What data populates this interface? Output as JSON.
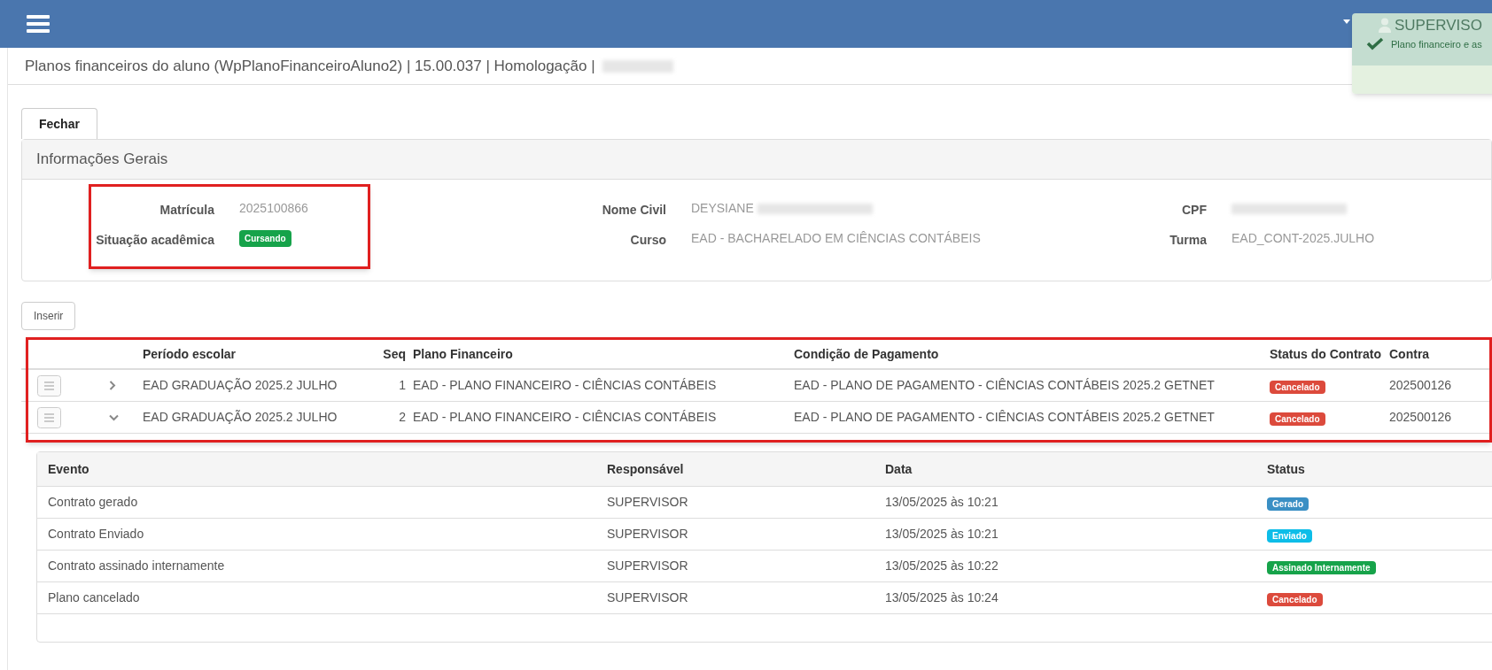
{
  "topbar": {
    "user": "SUPERVISO"
  },
  "toast": {
    "message": "Plano financeiro e as"
  },
  "page_title": {
    "text": "Planos financeiros do aluno (WpPlanoFinanceiroAluno2) | 15.00.037 | Homologação |",
    "redacted": true
  },
  "buttons": {
    "close": "Fechar",
    "insert": "Inserir"
  },
  "general_info": {
    "title": "Informações Gerais",
    "columns": [
      {
        "highlighted": true,
        "fields": [
          {
            "label": "Matrícula",
            "value": "2025100866",
            "kind": "text",
            "redacted": false
          },
          {
            "label": "Situação acadêmica",
            "value": "Cursando",
            "kind": "badge",
            "color": "#16a34a",
            "redacted": false
          }
        ]
      },
      {
        "highlighted": false,
        "fields": [
          {
            "label": "Nome Civil",
            "value": "DEYSIANE",
            "kind": "text",
            "redacted": true
          },
          {
            "label": "Curso",
            "value": "EAD - BACHARELADO EM CIÊNCIAS CONTÁBEIS",
            "kind": "text",
            "redacted": false
          }
        ]
      },
      {
        "highlighted": false,
        "fields": [
          {
            "label": "CPF",
            "kind": "hidden",
            "redacted": true
          },
          {
            "label": "Turma",
            "value": "EAD_CONT-2025.JULHO",
            "kind": "text",
            "redacted": false
          }
        ]
      }
    ]
  },
  "plans_table": {
    "highlighted": true,
    "columns": [
      "Período escolar",
      "Seq",
      "Plano Financeiro",
      "Condição de Pagamento",
      "Status do Contrato",
      "Contra"
    ],
    "rows": [
      {
        "expanded": false,
        "cells": [
          "EAD GRADUAÇÃO 2025.2 JULHO",
          "1",
          "EAD - PLANO FINANCEIRO - CIÊNCIAS CONTÁBEIS",
          "EAD - PLANO DE PAGAMENTO - CIÊNCIAS CONTÁBEIS 2025.2 GETNET"
        ],
        "status": {
          "text": "Cancelado",
          "color": "#dc4a3c"
        },
        "contract": "202500126"
      },
      {
        "expanded": true,
        "cells": [
          "EAD GRADUAÇÃO 2025.2 JULHO",
          "2",
          "EAD - PLANO FINANCEIRO - CIÊNCIAS CONTÁBEIS",
          "EAD - PLANO DE PAGAMENTO - CIÊNCIAS CONTÁBEIS 2025.2 GETNET"
        ],
        "status": {
          "text": "Cancelado",
          "color": "#dc4a3c"
        },
        "contract": "202500126"
      }
    ]
  },
  "events_table": {
    "columns": [
      "Evento",
      "Responsável",
      "Data",
      "Status"
    ],
    "rows": [
      {
        "cells": [
          "Contrato gerado",
          "SUPERVISOR",
          "13/05/2025 às 10:21"
        ],
        "status": {
          "text": "Gerado",
          "color": "#3a8fc4"
        }
      },
      {
        "cells": [
          "Contrato Enviado",
          "SUPERVISOR",
          "13/05/2025 às 10:21"
        ],
        "status": {
          "text": "Enviado",
          "color": "#0dbde8"
        }
      },
      {
        "cells": [
          "Contrato assinado internamente",
          "SUPERVISOR",
          "13/05/2025 às 10:22"
        ],
        "status": {
          "text": "Assinado Internamente",
          "color": "#16a34a"
        }
      },
      {
        "cells": [
          "Plano cancelado",
          "SUPERVISOR",
          "13/05/2025 às 10:24"
        ],
        "status": {
          "text": "Cancelado",
          "color": "#dc4a3c"
        }
      }
    ]
  }
}
